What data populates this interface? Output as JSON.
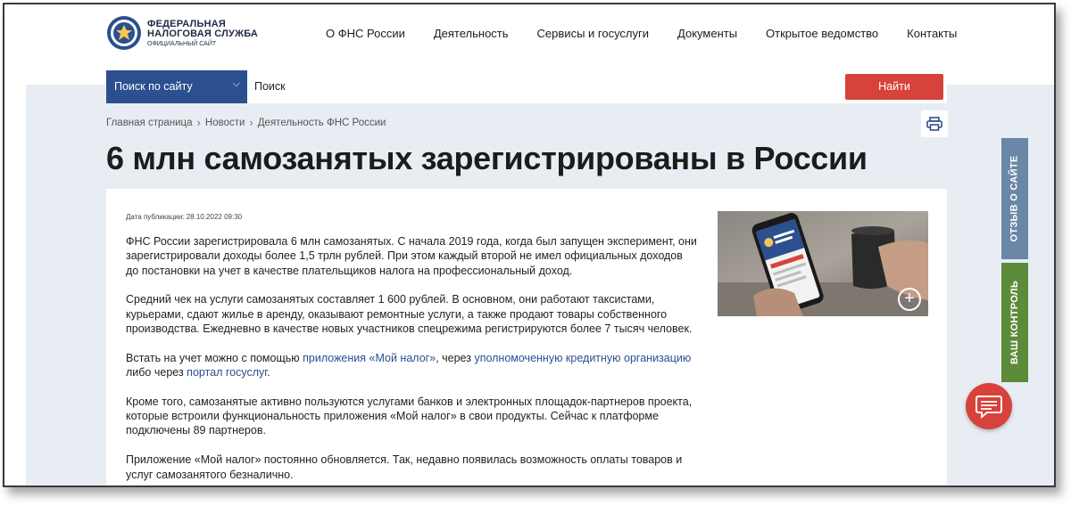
{
  "logo": {
    "line1": "ФЕДЕРАЛЬНАЯ",
    "line2": "НАЛОГОВАЯ СЛУЖБА",
    "line3": "ОФИЦИАЛЬНЫЙ САЙТ",
    "icon": "fns-emblem-icon"
  },
  "nav": [
    "О ФНС России",
    "Деятельность",
    "Сервисы и госуслуги",
    "Документы",
    "Открытое ведомство",
    "Контакты"
  ],
  "search": {
    "scope": "Поиск по сайту",
    "placeholder": "Поиск",
    "button": "Найти"
  },
  "breadcrumb": [
    "Главная страница",
    "Новости",
    "Деятельность ФНС России"
  ],
  "article": {
    "title": "6 млн самозанятых зарегистрированы в России",
    "pub_date": "Дата публикации: 28.10.2022 09:30",
    "p1": "ФНС России зарегистрировала 6 млн самозанятых. С начала 2019 года, когда был запущен эксперимент, они зарегистрировали доходы более 1,5 трлн рублей. При этом каждый второй не имел официальных доходов до постановки на учет в качестве плательщиков налога на профессиональный доход.",
    "p2": "Средний чек на услуги самозанятых составляет 1 600 рублей. В основном, они работают таксистами, курьерами, сдают жилье в аренду, оказывают ремонтные услуги, а также продают товары собственного производства. Ежедневно в качестве новых участников спецрежима регистрируются более 7 тысяч человек.",
    "p3_a": "Встать на учет можно с помощью ",
    "p3_link1": "приложения «Мой налог»",
    "p3_b": ", через ",
    "p3_link2": "уполномоченную кредитную организацию",
    "p3_c": " либо через ",
    "p3_link3": "портал госуслуг",
    "p3_d": ".",
    "p4": "Кроме того, самозанятые активно пользуются услугами банков и электронных площадок-партнеров проекта, которые встроили функциональность приложения «Мой налог» в свои продукты. Сейчас к платформе подключены 89 партнеров.",
    "p5": "Приложение «Мой налог» постоянно обновляется. Так, недавно появилась возможность оплаты товаров и услуг самозанятого безналично."
  },
  "side_tabs": {
    "feedback": "ОТЗЫВ О САЙТЕ",
    "control": "ВАШ КОНТРОЛЬ"
  },
  "colors": {
    "brand_blue": "#2b4f8f",
    "accent_red": "#d7423a",
    "feedback_tab": "#6a87a7",
    "control_tab": "#5c8b3a",
    "page_bg": "#e8edf3"
  }
}
